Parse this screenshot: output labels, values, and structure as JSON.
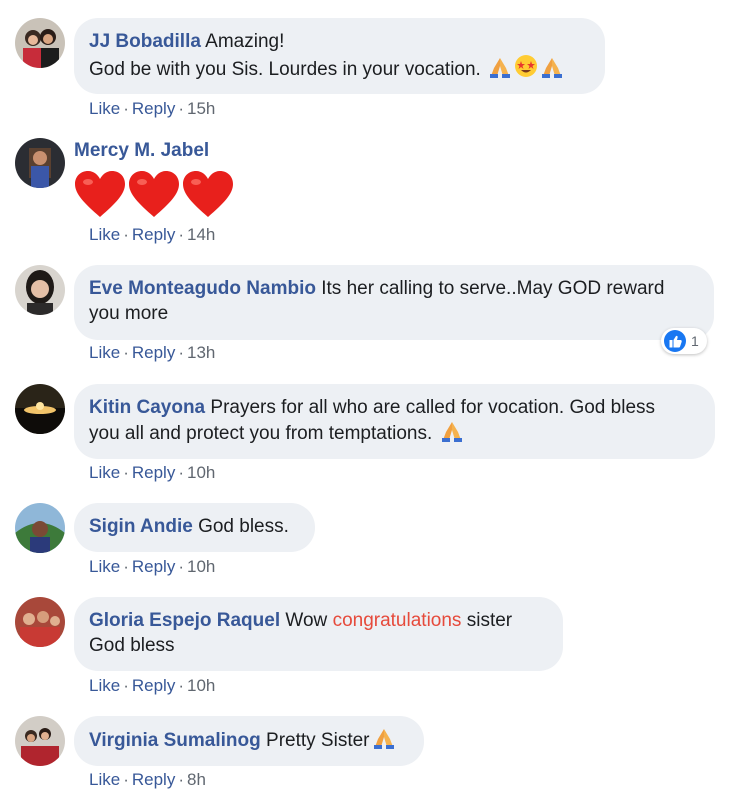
{
  "actions": {
    "like_label": "Like",
    "reply_label": "Reply",
    "separator": "·"
  },
  "comments": [
    {
      "author": "JJ Bobadilla",
      "text_line1": "Amazing!",
      "text_line2": "God be with you Sis. Lourdes in your vocation.",
      "time": "15h",
      "emoji": [
        "pray-icon",
        "star-struck-icon",
        "pray-icon"
      ]
    },
    {
      "author": "Mercy M. Jabel",
      "emoji": [
        "red-heart-icon",
        "red-heart-icon",
        "red-heart-icon"
      ],
      "time": "14h"
    },
    {
      "author": "Eve Monteagudo Nambio",
      "text_line1": "Its her calling to serve..May GOD reward",
      "text_line2": "you more",
      "time": "13h",
      "reaction_count": "1"
    },
    {
      "author": "Kitin Cayona",
      "text_line1": "Prayers for all who are called for vocation. God bless",
      "text_line2": "you all and protect you from temptations.",
      "time": "10h",
      "emoji": [
        "pray-icon"
      ]
    },
    {
      "author": "Sigin Andie",
      "text_line1": "God bless.",
      "time": "10h"
    },
    {
      "author": "Gloria Espejo Raquel",
      "text_before": "Wow",
      "text_highlight": "congratulations",
      "text_after": "sister",
      "text_line2": "God bless",
      "time": "10h"
    },
    {
      "author": "Virginia Sumalinog",
      "text_line1": "Pretty Sister",
      "time": "8h",
      "emoji": [
        "pray-icon"
      ]
    }
  ],
  "colors": {
    "author": "#385898",
    "bubble": "#edf0f4",
    "highlight": "#e64a3b",
    "like_blue": "#1877f2"
  }
}
